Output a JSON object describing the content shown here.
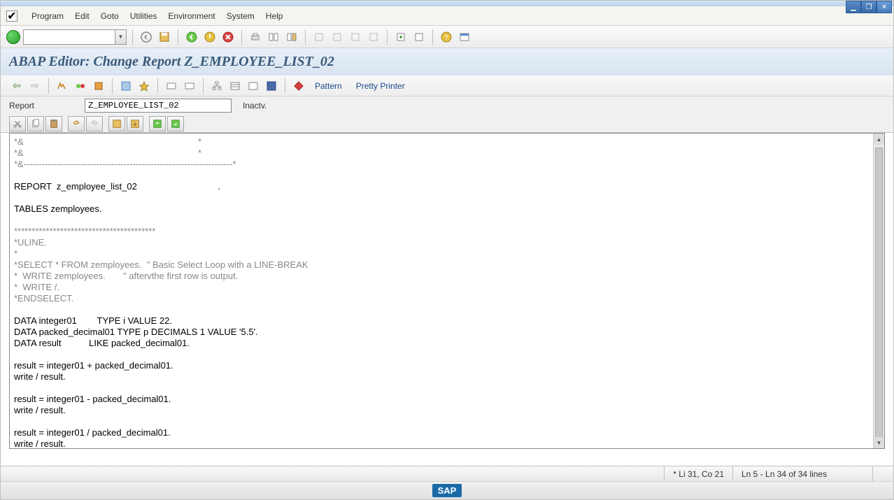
{
  "menu": {
    "items": [
      "Program",
      "Edit",
      "Goto",
      "Utilities",
      "Environment",
      "System",
      "Help"
    ]
  },
  "page_title": "ABAP Editor: Change Report Z_EMPLOYEE_LIST_02",
  "toolbar2": {
    "pattern": "Pattern",
    "pretty": "Pretty Printer"
  },
  "report": {
    "label": "Report",
    "name": "Z_EMPLOYEE_LIST_02",
    "status": "Inactv."
  },
  "code_lines": [
    {
      "t": "*&                                                                     *",
      "c": "dim"
    },
    {
      "t": "*&                                                                     *",
      "c": "dim"
    },
    {
      "t": "*&---------------------------------------------------------------------*",
      "c": "dim"
    },
    {
      "t": "",
      "c": ""
    },
    {
      "t": "REPORT  z_employee_list_02                                .",
      "c": ""
    },
    {
      "t": "",
      "c": ""
    },
    {
      "t": "TABLES zemployees.",
      "c": ""
    },
    {
      "t": "",
      "c": ""
    },
    {
      "t": "****************************************",
      "c": "dim"
    },
    {
      "t": "*ULINE.",
      "c": "dim"
    },
    {
      "t": "*",
      "c": "dim"
    },
    {
      "t": "*SELECT * FROM zemployees.  \" Basic Select Loop with a LINE-BREAK",
      "c": "dim"
    },
    {
      "t": "*  WRITE zemployees.       \" aftervthe first row is output.",
      "c": "dim"
    },
    {
      "t": "*  WRITE /.",
      "c": "dim"
    },
    {
      "t": "*ENDSELECT.",
      "c": "dim"
    },
    {
      "t": "",
      "c": ""
    },
    {
      "t": "DATA integer01        TYPE i VALUE 22.",
      "c": ""
    },
    {
      "t": "DATA packed_decimal01 TYPE p DECIMALS 1 VALUE '5.5'.",
      "c": ""
    },
    {
      "t": "DATA result           LIKE packed_decimal01.",
      "c": ""
    },
    {
      "t": "",
      "c": ""
    },
    {
      "t": "result = integer01 + packed_decimal01.",
      "c": ""
    },
    {
      "t": "write / result.",
      "c": ""
    },
    {
      "t": "",
      "c": ""
    },
    {
      "t": "result = integer01 - packed_decimal01.",
      "c": ""
    },
    {
      "t": "write / result.",
      "c": ""
    },
    {
      "t": "",
      "c": ""
    },
    {
      "t": "result = integer01 / packed_decimal01.",
      "c": ""
    },
    {
      "t": "write / result.",
      "c": ""
    }
  ],
  "statusbar": {
    "modified": "*",
    "pos": "Li 31, Co 21",
    "range": "Ln 5 - Ln 34 of 34 lines"
  },
  "footer_logo": "SAP"
}
